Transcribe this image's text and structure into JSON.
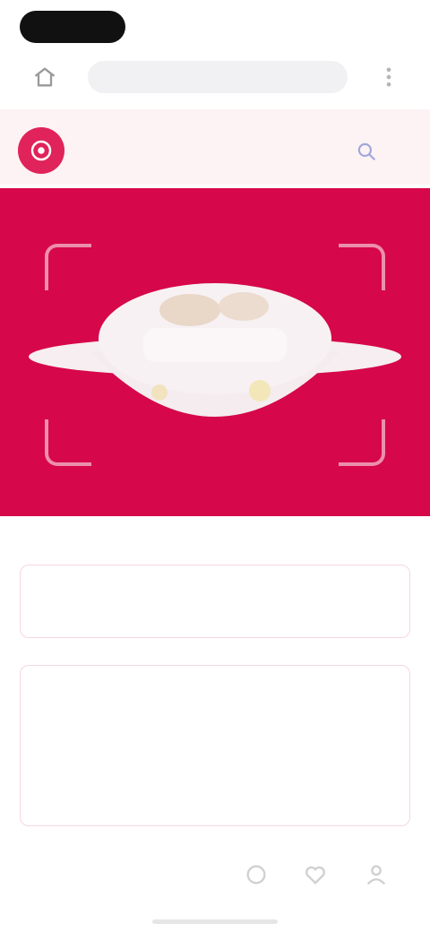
{
  "browser": {
    "url": "",
    "url_placeholder": ""
  },
  "site": {
    "logo_text": ""
  },
  "cards": {
    "one_label": "",
    "two_title": "",
    "two_body": ""
  },
  "colors": {
    "brand": "#d6074a",
    "accent": "#e0235a",
    "header_bg": "#fdf2f4"
  },
  "icons": {
    "home": "home-icon",
    "menu": "more-vertical-icon",
    "header": "search-icon",
    "nav": [
      "share-icon",
      "heart-icon",
      "user-icon"
    ]
  }
}
